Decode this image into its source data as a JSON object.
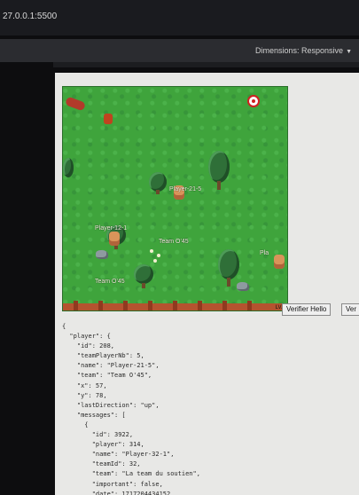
{
  "browser": {
    "url": "27.0.0.1:5500",
    "devtools_dimensions": "Dimensions: Responsive"
  },
  "game": {
    "labels": {
      "player_main": "Player-21-5",
      "team_main": "Team O'45",
      "player_left": "Player-12-1",
      "team_left": "Team O'45",
      "player_right": "Pla",
      "corner": "LV.3"
    }
  },
  "buttons": {
    "verify": "Verifier Hello",
    "second": "Ver"
  },
  "json_output": [
    "{",
    "  \"player\": {",
    "    \"id\": 208,",
    "    \"teamPlayerNb\": 5,",
    "    \"name\": \"Player-21-5\",",
    "    \"team\": \"Team O'45\",",
    "    \"x\": 57,",
    "    \"y\": 78,",
    "    \"lastDirection\": \"up\",",
    "    \"messages\": [",
    "      {",
    "        \"id\": 3922,",
    "        \"player\": 314,",
    "        \"name\": \"Player-32-1\",",
    "        \"teamId\": 32,",
    "        \"team\": \"La team du soutien\",",
    "        \"important\": false,",
    "        \"date\": 1717204434152,"
  ]
}
